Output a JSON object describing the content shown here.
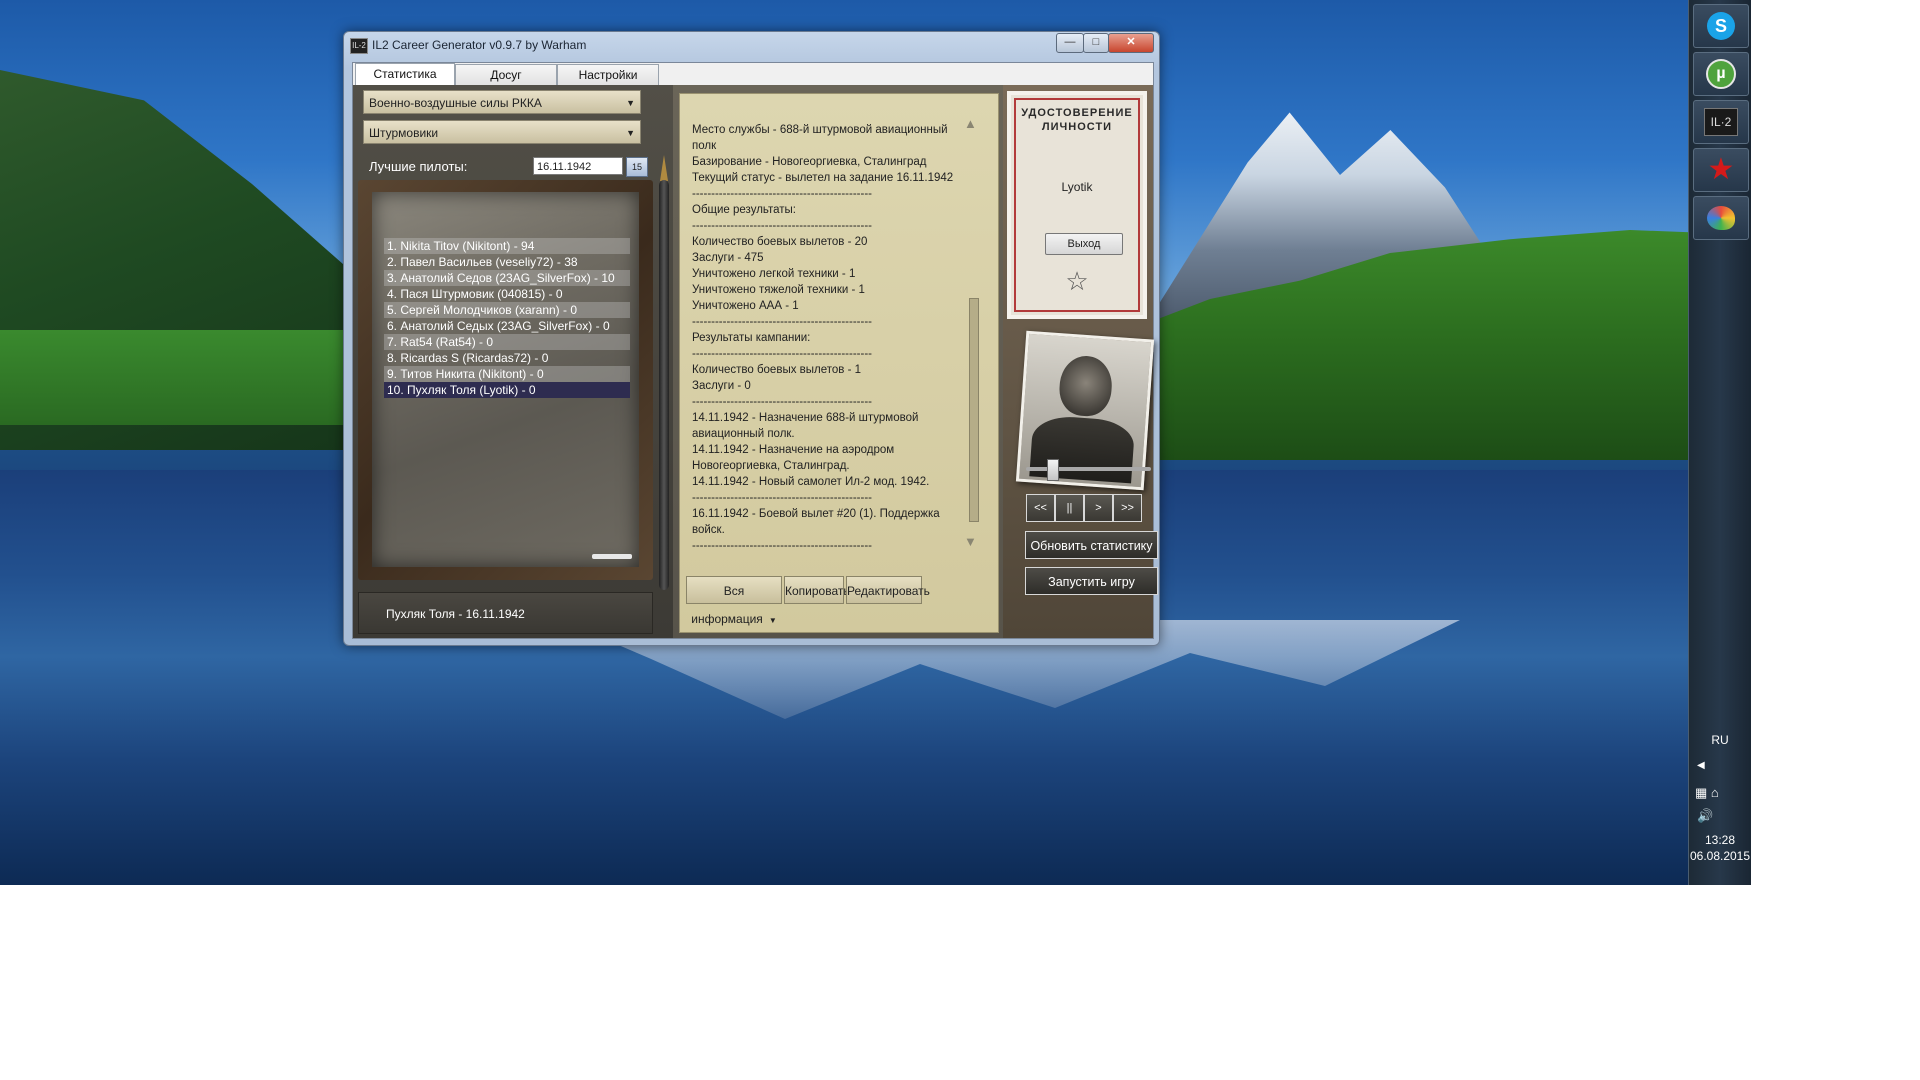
{
  "window": {
    "title": "IL2 Career Generator v0.9.7 by Warham",
    "app_icon_label": "IL-2",
    "minimize": "—",
    "maximize": "□",
    "close": "✕"
  },
  "tabs": [
    {
      "label": "Статистика",
      "active": true
    },
    {
      "label": "Досуг",
      "active": false
    },
    {
      "label": "Настройки",
      "active": false
    }
  ],
  "left": {
    "air_force_select": "Военно-воздушные силы РККА",
    "unit_type_select": "Штурмовики",
    "best_pilots_label": "Лучшие пилоты:",
    "date_value": "16.11.1942",
    "calendar_label": "15",
    "pilots": [
      "1. Nikita Titov (Nikitont) - 94",
      "2. Павел Васильев (veseliy72) - 38",
      "3. Анатолий Седов (23AG_SilverFox) - 10",
      "4. Пася Штурмовик (040815) - 0",
      "5. Сергей Молодчиков (xarann) - 0",
      "6. Анатолий Седых (23AG_SilverFox) - 0",
      "7. Rat54 (Rat54) - 0",
      "8. Ricardas S (Ricardas72) - 0",
      "9. Титов Никита (Nikitont) - 0",
      "10. Пухляк Толя (Lyotik) - 0"
    ],
    "selected_index": 9,
    "status": "Пухляк Толя - 16.11.1942"
  },
  "info_lines": [
    "Место службы - 688-й штурмовой авиационный полк",
    "Базирование - Новогеоргиевка, Сталинград",
    "Текущий статус - вылетел на задание 16.11.1942",
    "-----------------------------------------------",
    "Общие результаты:",
    "-----------------------------------------------",
    "Количество боевых вылетов - 20",
    "Заслуги - 475",
    "Уничтожено легкой техники - 1",
    "Уничтожено тяжелой техники - 1",
    "Уничтожено ААА - 1",
    "-----------------------------------------------",
    "Результаты кампании:",
    "-----------------------------------------------",
    "Количество боевых вылетов - 1",
    "Заслуги - 0",
    "-----------------------------------------------",
    "14.11.1942 - Назначение 688-й штурмовой авиационный полк.",
    "14.11.1942 - Назначение на аэродром Новогеоргиевка, Сталинград.",
    "14.11.1942 - Новый самолет Ил-2 мод. 1942.",
    "-----------------------------------------------",
    "16.11.1942 - Боевой вылет #20 (1). Поддержка войск.",
    "-----------------------------------------------"
  ],
  "info_buttons": {
    "filter_select": "Вся информация",
    "copy": "Копировать",
    "edit": "Редактировать"
  },
  "id_card": {
    "title": "УДОСТОВЕРЕНИЕ ЛИЧНОСТИ",
    "name": "Lyotik",
    "exit": "Выход"
  },
  "media": {
    "prev_prev": "<<",
    "pause": "||",
    "play": ">",
    "next_next": ">>"
  },
  "actions": {
    "refresh_stats": "Обновить статистику",
    "launch_game": "Запустить игру"
  },
  "taskbar": {
    "language": "RU",
    "time": "13:28",
    "date": "06.08.2015",
    "apps": [
      "skype-icon",
      "utorrent-icon",
      "il2-icon",
      "red-star-icon",
      "paint-icon"
    ]
  }
}
